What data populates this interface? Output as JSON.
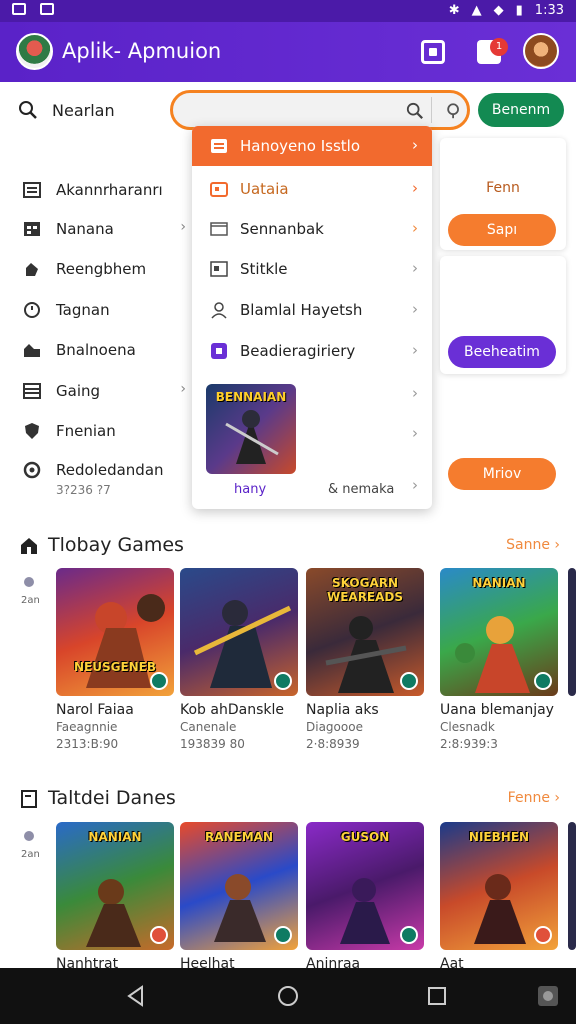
{
  "status_bar": {
    "time": "1:33"
  },
  "app_bar": {
    "title": "Aplik- Apmuion",
    "notification_count": "1"
  },
  "search": {
    "label": "Nearlan",
    "value": "",
    "button": "Benenm"
  },
  "sidebar": {
    "items": [
      {
        "label": "Akannrharanrı",
        "icon": "list-icon"
      },
      {
        "label": "Nanana",
        "icon": "table-icon"
      },
      {
        "label": "Reengbhem",
        "icon": "puzzle-icon"
      },
      {
        "label": "Tagnan",
        "icon": "clock-icon"
      },
      {
        "label": "Bnalnoena",
        "icon": "house-icon"
      },
      {
        "label": "Gaing",
        "icon": "grid-icon"
      },
      {
        "label": "Fnenian",
        "icon": "shield-icon"
      },
      {
        "label": "Redoledandan",
        "icon": "headset-icon"
      }
    ],
    "sub_text": "3?236 ?7"
  },
  "dropdown": {
    "header": "Hanoyeno Isstlo",
    "items": [
      {
        "label": "Uataia",
        "icon": "folder-icon"
      },
      {
        "label": "Sennanbak",
        "icon": "window-icon"
      },
      {
        "label": "Stitkle",
        "icon": "image-icon"
      },
      {
        "label": "Blamlal Hayetsh",
        "icon": "user-icon"
      },
      {
        "label": "Beadieragiriery",
        "icon": "purple-box-icon"
      }
    ],
    "thumb_title": "BENNAIAN",
    "footer_left": "hany",
    "footer_right": "& nemaka"
  },
  "right_panel": {
    "card1_text": "Fenn",
    "button1": "Sapı",
    "button2": "Beeheatim",
    "button3": "Mriov"
  },
  "sections": [
    {
      "title": "Tlobay Games",
      "link": "Sanne",
      "side_label": "2an",
      "games": [
        {
          "art_title": "NEUSGENEB",
          "name": "Narol Faiaa",
          "dev": "Faeagnnie",
          "stat": "2313:B:90"
        },
        {
          "art_title": "",
          "name": "Kob ahDanskle",
          "dev": "Canenale",
          "stat": "193839 80"
        },
        {
          "art_title": "SKOGARN WEAREADS",
          "name": "Naplia aks",
          "dev": "Diagoooe",
          "stat": "2·8:8939"
        },
        {
          "art_title": "NANIAN",
          "name": "Uana blemanjay",
          "dev": "Clesnadk",
          "stat": "2:8:939:3"
        }
      ]
    },
    {
      "title": "Taltdei Danes",
      "link": "Fenne",
      "side_label": "2an",
      "games": [
        {
          "art_title": "NANIAN",
          "name": "Nanhtrat",
          "dev": "",
          "stat": ""
        },
        {
          "art_title": "RANEMAN",
          "name": "Heelhat",
          "dev": "",
          "stat": ""
        },
        {
          "art_title": "GUSON",
          "name": "Aninraa",
          "dev": "",
          "stat": ""
        },
        {
          "art_title": "NIEBHEN",
          "name": "Aat",
          "dev": "",
          "stat": ""
        }
      ]
    }
  ],
  "colors": {
    "primary": "#5a22c8",
    "accent": "#f26a2e",
    "green": "#138a52",
    "link": "#f08a3e"
  }
}
